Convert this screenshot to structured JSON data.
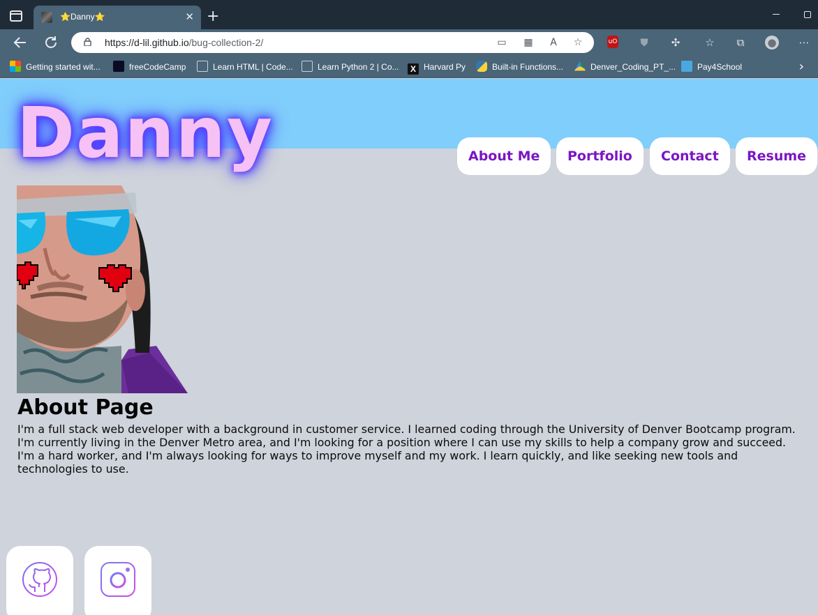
{
  "browser": {
    "tab_title": "⭐Danny⭐",
    "tab_close": "✕",
    "new_tab": "+",
    "url_host": "https://d-lil.github.io",
    "url_path": "/bug-collection-2/",
    "bookmarks": [
      {
        "label": "Getting started wit...",
        "icon": "microsoft-icon"
      },
      {
        "label": "freeCodeCamp",
        "icon": "freecodecamp-icon"
      },
      {
        "label": "Learn HTML | Code...",
        "icon": "codecademy-icon"
      },
      {
        "label": "Learn Python 2 | Co...",
        "icon": "codecademy-icon"
      },
      {
        "label": "Harvard Py",
        "icon": "x-icon"
      },
      {
        "label": "Built-in Functions...",
        "icon": "python-icon"
      },
      {
        "label": "Denver_Coding_PT_...",
        "icon": "google-drive-icon"
      },
      {
        "label": "Pay4School",
        "icon": "square-icon"
      }
    ],
    "bookmarks_more": "›"
  },
  "site": {
    "logo": "Danny",
    "nav": [
      {
        "label": "About Me"
      },
      {
        "label": "Portfolio"
      },
      {
        "label": "Contact"
      },
      {
        "label": "Resume"
      }
    ],
    "about_title": "About Page",
    "about_text": "I'm a full stack web developer with a background in customer service. I learned coding through the University of Denver Bootcamp program. I'm currently living in the Denver Metro area, and I'm looking for a position where I can use my skills to help a company grow and succeed. I'm a hard worker, and I'm always looking for ways to improve myself and my work. I learn quickly, and like seeking new tools and technologies to use.",
    "social": [
      {
        "icon": "github-icon"
      },
      {
        "icon": "instagram-icon"
      }
    ]
  },
  "colors": {
    "hero_band": "#80cefb",
    "page_bg": "#cfd3db",
    "nav_text": "#7a16c4",
    "logo_fill": "#f6c1f4",
    "logo_glow": "#4b3fff"
  }
}
